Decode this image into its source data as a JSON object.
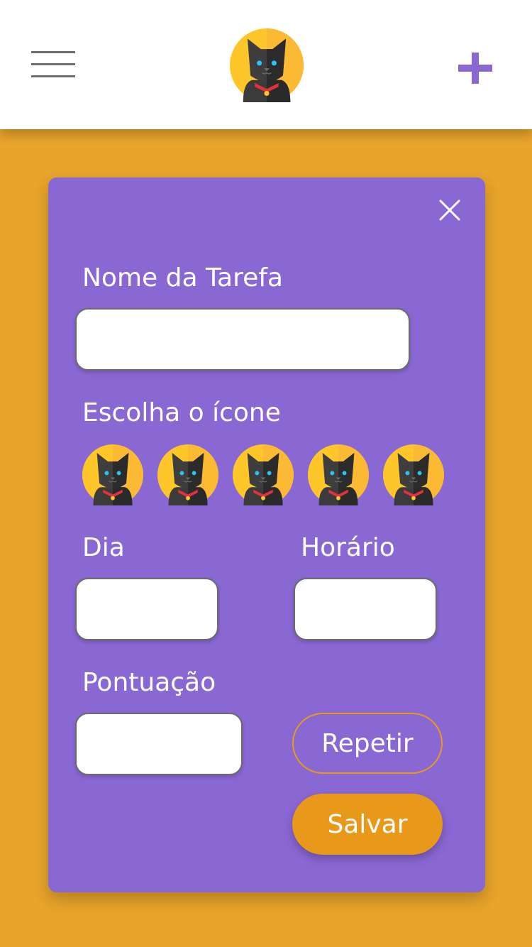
{
  "header": {
    "logo_icon": "black-cat-avatar-icon",
    "menu_icon": "hamburger-menu-icon",
    "add_icon": "plus-icon",
    "accent_color": "#8A67D4"
  },
  "colors": {
    "background": "#E8A42B",
    "card": "#8A68D4",
    "button_primary": "#E8991A"
  },
  "form": {
    "close_icon": "close-icon",
    "task_name_label": "Nome da Tarefa",
    "task_name_value": "",
    "icon_label": "Escolha o ícone",
    "icons": [
      "cat-icon",
      "cat-icon",
      "cat-icon",
      "cat-icon",
      "cat-icon"
    ],
    "day_label": "Dia",
    "day_value": "",
    "time_label": "Horário",
    "time_value": "",
    "score_label": "Pontuação",
    "score_value": "",
    "repeat_label": "Repetir",
    "save_label": "Salvar"
  }
}
